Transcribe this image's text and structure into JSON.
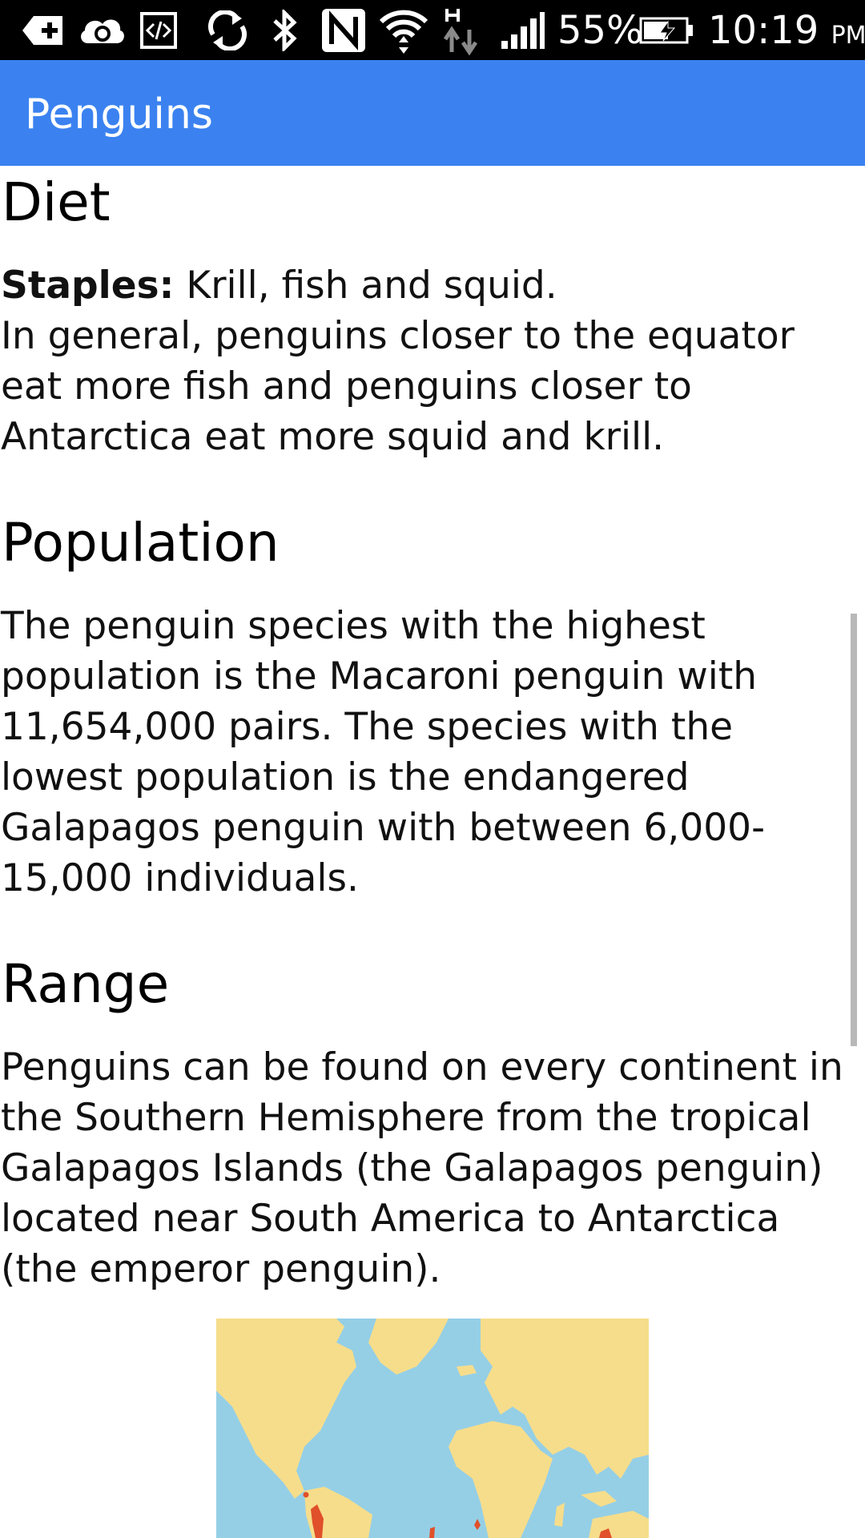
{
  "status_bar": {
    "battery_percent": "55%",
    "time": "10:19",
    "ampm": "PM",
    "network_type": "H",
    "icons": [
      "add-notification-icon",
      "cloud-sync-icon",
      "developer-code-icon",
      "sync-icon",
      "bluetooth-icon",
      "nfc-icon",
      "wifi-icon",
      "data-transfer-icon",
      "signal-icon",
      "battery-charging-icon"
    ]
  },
  "app_bar": {
    "title": "Penguins"
  },
  "sections": {
    "diet": {
      "heading": "Diet",
      "staples_label": "Staples:",
      "staples_text": " Krill, fish and squid.",
      "body": "In general, penguins closer to the equator eat more fish and penguins closer to Antarctica eat more squid and krill."
    },
    "population": {
      "heading": "Population",
      "body": "The penguin species with the highest population is the Macaroni penguin with 11,654,000 pairs. The species with the lowest population is the endangered Galapagos penguin with between 6,000-15,000 individuals."
    },
    "range": {
      "heading": "Range",
      "body": "Penguins can be found on every continent in the Southern Hemisphere from the tropical Galapagos Islands (the Galapagos penguin) located near South America to Antarctica (the emperor penguin)."
    }
  },
  "colors": {
    "app_bar": "#3b82f0",
    "ocean": "#95cfe6",
    "land": "#f6dd8b",
    "range": "#e0502a"
  }
}
